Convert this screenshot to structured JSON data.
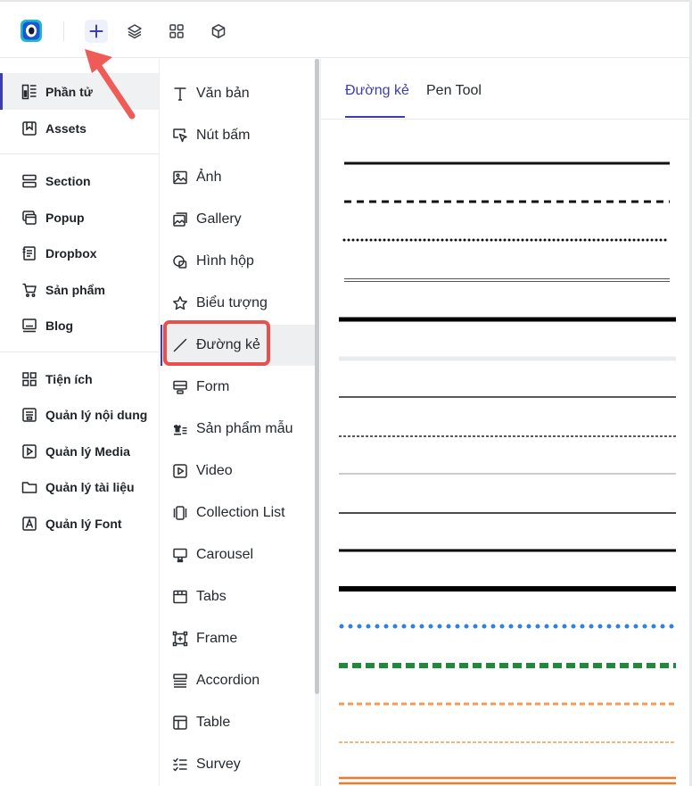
{
  "toolbar": {
    "icons": [
      "app-logo",
      "add-icon",
      "layers-icon",
      "grid-icon",
      "package-icon"
    ],
    "accent": "#3d3db3"
  },
  "left_nav": {
    "groups": [
      [
        {
          "label": "Phần tử",
          "icon": "elements-icon",
          "active": true
        },
        {
          "label": "Assets",
          "icon": "bookmark-icon"
        }
      ],
      [
        {
          "label": "Section",
          "icon": "section-icon"
        },
        {
          "label": "Popup",
          "icon": "popup-icon"
        },
        {
          "label": "Dropbox",
          "icon": "dropbox-icon"
        },
        {
          "label": "Sản phẩm",
          "icon": "cart-icon"
        },
        {
          "label": "Blog",
          "icon": "blog-icon"
        }
      ],
      [
        {
          "label": "Tiện ích",
          "icon": "utilities-icon"
        },
        {
          "label": "Quản lý nội dung",
          "icon": "content-manager-icon"
        },
        {
          "label": "Quản lý Media",
          "icon": "media-manager-icon"
        },
        {
          "label": "Quản lý tài liệu",
          "icon": "folder-icon"
        },
        {
          "label": "Quản lý Font",
          "icon": "font-icon"
        }
      ]
    ]
  },
  "elements_list": {
    "items": [
      {
        "label": "Văn bản",
        "icon": "text-icon"
      },
      {
        "label": "Nút bấm",
        "icon": "button-cursor-icon"
      },
      {
        "label": "Ảnh",
        "icon": "image-icon"
      },
      {
        "label": "Gallery",
        "icon": "gallery-icon"
      },
      {
        "label": "Hình hộp",
        "icon": "shape-icon"
      },
      {
        "label": "Biểu tượng",
        "icon": "star-icon"
      },
      {
        "label": "Đường kẻ",
        "icon": "line-icon",
        "active": true
      },
      {
        "label": "Form",
        "icon": "form-icon"
      },
      {
        "label": "Sản phẩm mẫu",
        "icon": "product-sample-icon"
      },
      {
        "label": "Video",
        "icon": "video-icon"
      },
      {
        "label": "Collection List",
        "icon": "collection-icon"
      },
      {
        "label": "Carousel",
        "icon": "carousel-icon"
      },
      {
        "label": "Tabs",
        "icon": "tabs-icon"
      },
      {
        "label": "Frame",
        "icon": "frame-icon"
      },
      {
        "label": "Accordion",
        "icon": "accordion-icon"
      },
      {
        "label": "Table",
        "icon": "table-icon"
      },
      {
        "label": "Survey",
        "icon": "survey-icon"
      }
    ],
    "highlight_color": "#e8504d"
  },
  "panel": {
    "tabs": [
      {
        "label": "Đường kẻ",
        "active": true
      },
      {
        "label": "Pen Tool",
        "active": false
      }
    ],
    "line_styles": [
      {
        "style": "solid",
        "color": "#111111",
        "weight": "medium"
      },
      {
        "style": "dashed",
        "color": "#111111",
        "weight": "medium"
      },
      {
        "style": "dotted",
        "color": "#111111",
        "weight": "medium"
      },
      {
        "style": "double",
        "color": "#555555",
        "weight": "thin"
      },
      {
        "style": "solid",
        "color": "#000000",
        "weight": "thick"
      },
      {
        "style": "solid",
        "color": "#e9ecef",
        "weight": "thick"
      },
      {
        "style": "solid",
        "color": "#222222",
        "weight": "thin"
      },
      {
        "style": "dashed",
        "color": "#222222",
        "weight": "thin"
      },
      {
        "style": "solid",
        "color": "#999999",
        "weight": "hairline"
      },
      {
        "style": "solid",
        "color": "#333333",
        "weight": "thin"
      },
      {
        "style": "solid",
        "color": "#000000",
        "weight": "medium"
      },
      {
        "style": "solid",
        "color": "#000000",
        "weight": "heavy"
      },
      {
        "style": "dotted",
        "color": "#2f7fe8",
        "weight": "thick"
      },
      {
        "style": "dashed",
        "color": "#1e8a3c",
        "weight": "heavy"
      },
      {
        "style": "dashed",
        "color": "#f49a52",
        "weight": "medium"
      },
      {
        "style": "dashed",
        "color": "#f49a52",
        "weight": "thin"
      },
      {
        "style": "double",
        "color": "#ef7a2e",
        "weight": "medium"
      }
    ]
  }
}
